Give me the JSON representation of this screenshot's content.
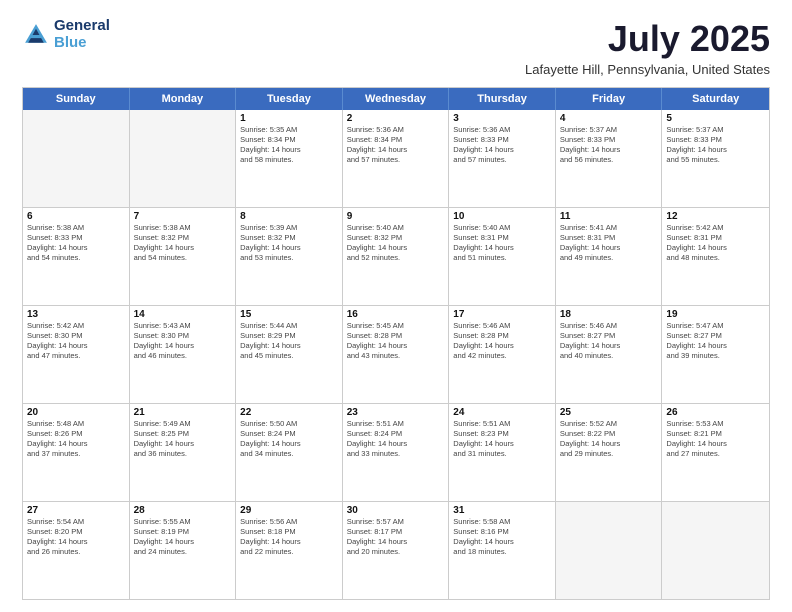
{
  "header": {
    "logo_line1": "General",
    "logo_line2": "Blue",
    "title": "July 2025",
    "subtitle": "Lafayette Hill, Pennsylvania, United States"
  },
  "calendar": {
    "days": [
      "Sunday",
      "Monday",
      "Tuesday",
      "Wednesday",
      "Thursday",
      "Friday",
      "Saturday"
    ],
    "rows": [
      [
        {
          "day": "",
          "empty": true
        },
        {
          "day": "",
          "empty": true
        },
        {
          "day": "1",
          "line1": "Sunrise: 5:35 AM",
          "line2": "Sunset: 8:34 PM",
          "line3": "Daylight: 14 hours",
          "line4": "and 58 minutes."
        },
        {
          "day": "2",
          "line1": "Sunrise: 5:36 AM",
          "line2": "Sunset: 8:34 PM",
          "line3": "Daylight: 14 hours",
          "line4": "and 57 minutes."
        },
        {
          "day": "3",
          "line1": "Sunrise: 5:36 AM",
          "line2": "Sunset: 8:33 PM",
          "line3": "Daylight: 14 hours",
          "line4": "and 57 minutes."
        },
        {
          "day": "4",
          "line1": "Sunrise: 5:37 AM",
          "line2": "Sunset: 8:33 PM",
          "line3": "Daylight: 14 hours",
          "line4": "and 56 minutes."
        },
        {
          "day": "5",
          "line1": "Sunrise: 5:37 AM",
          "line2": "Sunset: 8:33 PM",
          "line3": "Daylight: 14 hours",
          "line4": "and 55 minutes."
        }
      ],
      [
        {
          "day": "6",
          "line1": "Sunrise: 5:38 AM",
          "line2": "Sunset: 8:33 PM",
          "line3": "Daylight: 14 hours",
          "line4": "and 54 minutes."
        },
        {
          "day": "7",
          "line1": "Sunrise: 5:38 AM",
          "line2": "Sunset: 8:32 PM",
          "line3": "Daylight: 14 hours",
          "line4": "and 54 minutes."
        },
        {
          "day": "8",
          "line1": "Sunrise: 5:39 AM",
          "line2": "Sunset: 8:32 PM",
          "line3": "Daylight: 14 hours",
          "line4": "and 53 minutes."
        },
        {
          "day": "9",
          "line1": "Sunrise: 5:40 AM",
          "line2": "Sunset: 8:32 PM",
          "line3": "Daylight: 14 hours",
          "line4": "and 52 minutes."
        },
        {
          "day": "10",
          "line1": "Sunrise: 5:40 AM",
          "line2": "Sunset: 8:31 PM",
          "line3": "Daylight: 14 hours",
          "line4": "and 51 minutes."
        },
        {
          "day": "11",
          "line1": "Sunrise: 5:41 AM",
          "line2": "Sunset: 8:31 PM",
          "line3": "Daylight: 14 hours",
          "line4": "and 49 minutes."
        },
        {
          "day": "12",
          "line1": "Sunrise: 5:42 AM",
          "line2": "Sunset: 8:31 PM",
          "line3": "Daylight: 14 hours",
          "line4": "and 48 minutes."
        }
      ],
      [
        {
          "day": "13",
          "line1": "Sunrise: 5:42 AM",
          "line2": "Sunset: 8:30 PM",
          "line3": "Daylight: 14 hours",
          "line4": "and 47 minutes."
        },
        {
          "day": "14",
          "line1": "Sunrise: 5:43 AM",
          "line2": "Sunset: 8:30 PM",
          "line3": "Daylight: 14 hours",
          "line4": "and 46 minutes."
        },
        {
          "day": "15",
          "line1": "Sunrise: 5:44 AM",
          "line2": "Sunset: 8:29 PM",
          "line3": "Daylight: 14 hours",
          "line4": "and 45 minutes."
        },
        {
          "day": "16",
          "line1": "Sunrise: 5:45 AM",
          "line2": "Sunset: 8:28 PM",
          "line3": "Daylight: 14 hours",
          "line4": "and 43 minutes."
        },
        {
          "day": "17",
          "line1": "Sunrise: 5:46 AM",
          "line2": "Sunset: 8:28 PM",
          "line3": "Daylight: 14 hours",
          "line4": "and 42 minutes."
        },
        {
          "day": "18",
          "line1": "Sunrise: 5:46 AM",
          "line2": "Sunset: 8:27 PM",
          "line3": "Daylight: 14 hours",
          "line4": "and 40 minutes."
        },
        {
          "day": "19",
          "line1": "Sunrise: 5:47 AM",
          "line2": "Sunset: 8:27 PM",
          "line3": "Daylight: 14 hours",
          "line4": "and 39 minutes."
        }
      ],
      [
        {
          "day": "20",
          "line1": "Sunrise: 5:48 AM",
          "line2": "Sunset: 8:26 PM",
          "line3": "Daylight: 14 hours",
          "line4": "and 37 minutes."
        },
        {
          "day": "21",
          "line1": "Sunrise: 5:49 AM",
          "line2": "Sunset: 8:25 PM",
          "line3": "Daylight: 14 hours",
          "line4": "and 36 minutes."
        },
        {
          "day": "22",
          "line1": "Sunrise: 5:50 AM",
          "line2": "Sunset: 8:24 PM",
          "line3": "Daylight: 14 hours",
          "line4": "and 34 minutes."
        },
        {
          "day": "23",
          "line1": "Sunrise: 5:51 AM",
          "line2": "Sunset: 8:24 PM",
          "line3": "Daylight: 14 hours",
          "line4": "and 33 minutes."
        },
        {
          "day": "24",
          "line1": "Sunrise: 5:51 AM",
          "line2": "Sunset: 8:23 PM",
          "line3": "Daylight: 14 hours",
          "line4": "and 31 minutes."
        },
        {
          "day": "25",
          "line1": "Sunrise: 5:52 AM",
          "line2": "Sunset: 8:22 PM",
          "line3": "Daylight: 14 hours",
          "line4": "and 29 minutes."
        },
        {
          "day": "26",
          "line1": "Sunrise: 5:53 AM",
          "line2": "Sunset: 8:21 PM",
          "line3": "Daylight: 14 hours",
          "line4": "and 27 minutes."
        }
      ],
      [
        {
          "day": "27",
          "line1": "Sunrise: 5:54 AM",
          "line2": "Sunset: 8:20 PM",
          "line3": "Daylight: 14 hours",
          "line4": "and 26 minutes."
        },
        {
          "day": "28",
          "line1": "Sunrise: 5:55 AM",
          "line2": "Sunset: 8:19 PM",
          "line3": "Daylight: 14 hours",
          "line4": "and 24 minutes."
        },
        {
          "day": "29",
          "line1": "Sunrise: 5:56 AM",
          "line2": "Sunset: 8:18 PM",
          "line3": "Daylight: 14 hours",
          "line4": "and 22 minutes."
        },
        {
          "day": "30",
          "line1": "Sunrise: 5:57 AM",
          "line2": "Sunset: 8:17 PM",
          "line3": "Daylight: 14 hours",
          "line4": "and 20 minutes."
        },
        {
          "day": "31",
          "line1": "Sunrise: 5:58 AM",
          "line2": "Sunset: 8:16 PM",
          "line3": "Daylight: 14 hours",
          "line4": "and 18 minutes."
        },
        {
          "day": "",
          "empty": true
        },
        {
          "day": "",
          "empty": true
        }
      ]
    ]
  }
}
